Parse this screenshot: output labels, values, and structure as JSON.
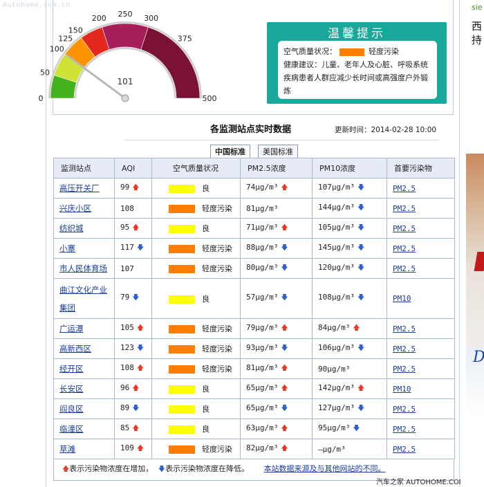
{
  "watermark": "Autohome.com.cn",
  "gauge": {
    "ticks": [
      "0",
      "50",
      "100",
      "125",
      "150",
      "200",
      "250",
      "300",
      "375",
      "500"
    ],
    "current_value": 101,
    "current_label": "101",
    "bands": [
      {
        "from": 0,
        "to": 50,
        "color": "#44b21c"
      },
      {
        "from": 50,
        "to": 100,
        "color": "#cfe336"
      },
      {
        "from": 100,
        "to": 150,
        "color": "#ff9400"
      },
      {
        "from": 150,
        "to": 200,
        "color": "#e5281d"
      },
      {
        "from": 200,
        "to": 300,
        "color": "#a61e5a"
      },
      {
        "from": 300,
        "to": 500,
        "color": "#7a1236"
      }
    ]
  },
  "tip": {
    "title": "温馨提示",
    "quality_label": "空气质量状况：",
    "quality_value": "轻度污染",
    "advice": "健康建议：儿童、老年人及心脏、呼吸系统疾病患者人群应减少长时间或高强度户外锻炼"
  },
  "section": {
    "title": "各监测站点实时数据",
    "update_label": "更新时间：2014-02-28 10:00"
  },
  "tabs": [
    {
      "label": "中国标准",
      "active": true
    },
    {
      "label": "美国标准",
      "active": false
    }
  ],
  "table": {
    "headers": [
      "监测站点",
      "AQI",
      "空气质量状况",
      "PM2.5浓度",
      "PM10浓度",
      "首要污染物"
    ],
    "rows": [
      {
        "station": "高压开关厂",
        "aqi": "99",
        "aqi_trend": "up",
        "level": "良",
        "level_color": "#ffff00",
        "pm25": "74μg/m³",
        "pm25_trend": "up",
        "pm10": "107μg/m³",
        "pm10_trend": "down",
        "primary": "PM2.5"
      },
      {
        "station": "兴庆小区",
        "aqi": "108",
        "aqi_trend": "",
        "level": "轻度污染",
        "level_color": "#ff7e00",
        "pm25": "81μg/m³",
        "pm25_trend": "",
        "pm10": "144μg/m³",
        "pm10_trend": "down",
        "primary": "PM2.5"
      },
      {
        "station": "纺织城",
        "aqi": "95",
        "aqi_trend": "up",
        "level": "良",
        "level_color": "#ffff00",
        "pm25": "71μg/m³",
        "pm25_trend": "up",
        "pm10": "105μg/m³",
        "pm10_trend": "down",
        "primary": "PM2.5"
      },
      {
        "station": "小寨",
        "aqi": "117",
        "aqi_trend": "down",
        "level": "轻度污染",
        "level_color": "#ff7e00",
        "pm25": "88μg/m³",
        "pm25_trend": "down",
        "pm10": "145μg/m³",
        "pm10_trend": "down",
        "primary": "PM2.5"
      },
      {
        "station": "市人民体育场",
        "aqi": "107",
        "aqi_trend": "",
        "level": "轻度污染",
        "level_color": "#ff7e00",
        "pm25": "80μg/m³",
        "pm25_trend": "down",
        "pm10": "120μg/m³",
        "pm10_trend": "down",
        "primary": "PM2.5"
      },
      {
        "station": "曲江文化产业集团",
        "aqi": "79",
        "aqi_trend": "down",
        "level": "良",
        "level_color": "#ffff00",
        "pm25": "57μg/m³",
        "pm25_trend": "down",
        "pm10": "108μg/m³",
        "pm10_trend": "down",
        "primary": "PM10",
        "tall": true
      },
      {
        "station": "广运潭",
        "aqi": "105",
        "aqi_trend": "up",
        "level": "轻度污染",
        "level_color": "#ff7e00",
        "pm25": "79μg/m³",
        "pm25_trend": "up",
        "pm10": "84μg/m³",
        "pm10_trend": "up",
        "primary": "PM2.5"
      },
      {
        "station": "高新西区",
        "aqi": "123",
        "aqi_trend": "down",
        "level": "轻度污染",
        "level_color": "#ff7e00",
        "pm25": "93μg/m³",
        "pm25_trend": "down",
        "pm10": "106μg/m³",
        "pm10_trend": "down",
        "primary": "PM2.5"
      },
      {
        "station": "经开区",
        "aqi": "108",
        "aqi_trend": "up",
        "level": "轻度污染",
        "level_color": "#ff7e00",
        "pm25": "81μg/m³",
        "pm25_trend": "up",
        "pm10": "90μg/m³",
        "pm10_trend": "",
        "primary": "PM2.5"
      },
      {
        "station": "长安区",
        "aqi": "96",
        "aqi_trend": "up",
        "level": "良",
        "level_color": "#ffff00",
        "pm25": "65μg/m³",
        "pm25_trend": "up",
        "pm10": "142μg/m³",
        "pm10_trend": "up",
        "primary": "PM10"
      },
      {
        "station": "阎良区",
        "aqi": "89",
        "aqi_trend": "down",
        "level": "良",
        "level_color": "#ffff00",
        "pm25": "65μg/m³",
        "pm25_trend": "down",
        "pm10": "127μg/m³",
        "pm10_trend": "down",
        "primary": "PM2.5"
      },
      {
        "station": "临潼区",
        "aqi": "85",
        "aqi_trend": "up",
        "level": "良",
        "level_color": "#ffff00",
        "pm25": "63μg/m³",
        "pm25_trend": "up",
        "pm10": "95μg/m³",
        "pm10_trend": "down",
        "primary": "PM2.5"
      },
      {
        "station": "草滩",
        "aqi": "109",
        "aqi_trend": "up",
        "level": "轻度污染",
        "level_color": "#ff7e00",
        "pm25": "82μg/m³",
        "pm25_trend": "up",
        "pm10": "—μg/m³",
        "pm10_trend": "",
        "primary": "PM2.5"
      }
    ]
  },
  "legend": {
    "up_text": "表示污染物浓度在增加，",
    "down_text": "表示污染物浓度在降低。",
    "link": "本站数据来源及与其他网站的不同。"
  },
  "footer_mark": "汽车之家 AUTOHOME.COM.CN",
  "right_col": {
    "t1": "sie",
    "t2": "西",
    "t3": "持"
  }
}
